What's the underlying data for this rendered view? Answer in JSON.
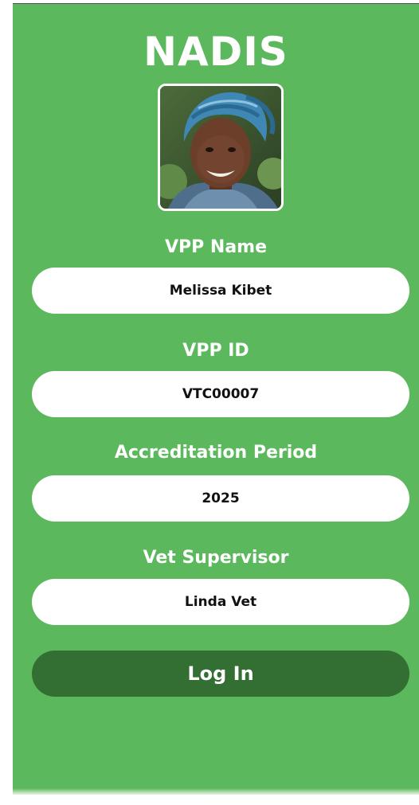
{
  "app": {
    "title": "NADIS"
  },
  "profile": {
    "photo_icon": "profile-photo"
  },
  "fields": {
    "vpp_name": {
      "label": "VPP Name",
      "value": "Melissa Kibet"
    },
    "vpp_id": {
      "label": "VPP ID",
      "value": "VTC00007"
    },
    "accreditation_period": {
      "label": "Accreditation Period",
      "value": "2025"
    },
    "vet_supervisor": {
      "label": "Vet Supervisor",
      "value": "Linda Vet"
    }
  },
  "actions": {
    "login_label": "Log In"
  },
  "colors": {
    "background": "#5cb85c",
    "button": "#336e33",
    "field": "#ffffff",
    "text_light": "#ffffff",
    "text_dark": "#111111"
  }
}
